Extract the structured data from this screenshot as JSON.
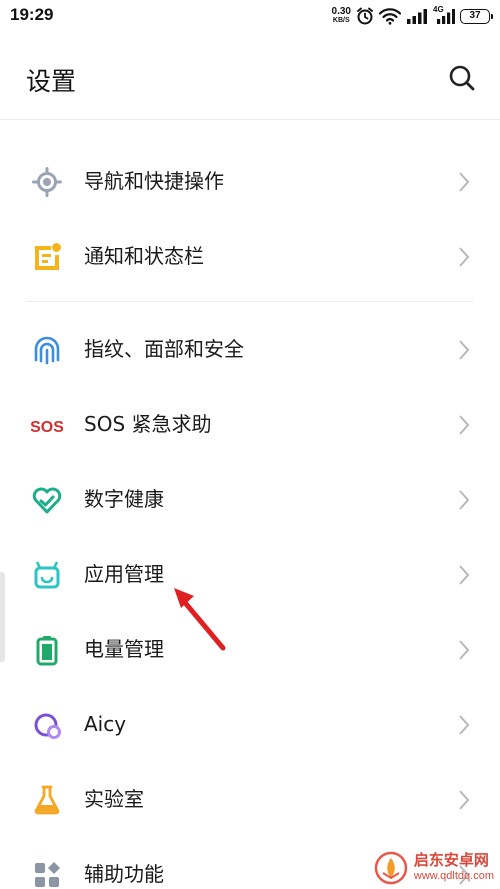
{
  "status_bar": {
    "time": "19:29",
    "net_speed_value": "0.30",
    "net_speed_unit": "KB/S",
    "network_type": "4G",
    "battery_level": "37"
  },
  "header": {
    "title": "设置",
    "search_icon": "search-icon"
  },
  "settings": [
    {
      "label": "导航和快捷操作",
      "icon": "navigation-icon",
      "color": "#9aa4b4"
    },
    {
      "label": "通知和状态栏",
      "icon": "notification-icon",
      "color": "#f5b51a"
    },
    {
      "label": "指纹、面部和安全",
      "icon": "fingerprint-icon",
      "color": "#3a8de0"
    },
    {
      "label": "SOS 紧急求助",
      "icon": "sos-icon",
      "color": "#d32f2f"
    },
    {
      "label": "数字健康",
      "icon": "digital-wellbeing-icon",
      "color": "#1fae8a"
    },
    {
      "label": "应用管理",
      "icon": "app-management-icon",
      "color": "#2ec4c4"
    },
    {
      "label": "电量管理",
      "icon": "battery-icon",
      "color": "#1faa6a"
    },
    {
      "label": "Aicy",
      "icon": "aicy-icon",
      "color": "#7b4fd6"
    },
    {
      "label": "实验室",
      "icon": "lab-icon",
      "color": "#f5a623"
    },
    {
      "label": "辅助功能",
      "icon": "accessibility-icon",
      "color": "#8a95a5"
    }
  ],
  "watermark": {
    "name": "启东安卓网",
    "url": "www.qdltdq.com"
  }
}
